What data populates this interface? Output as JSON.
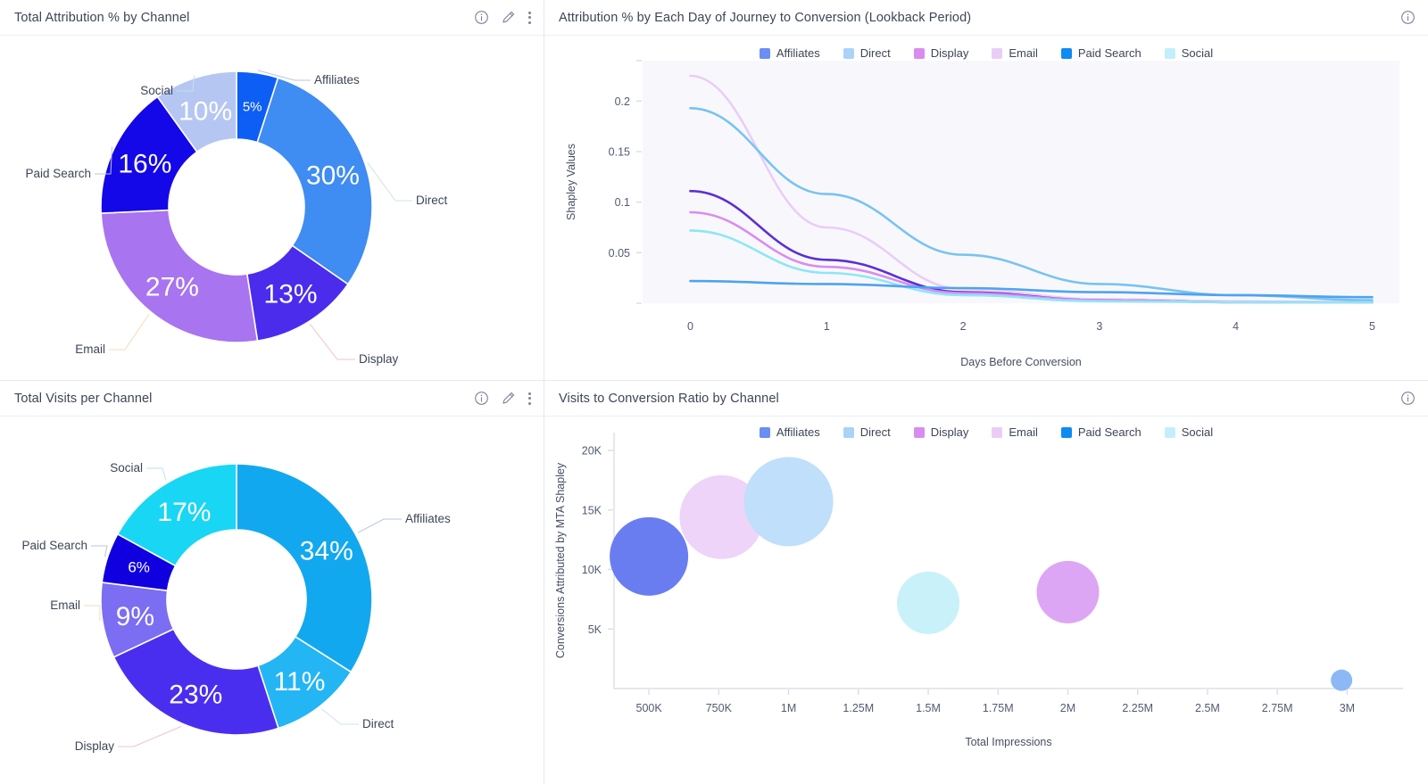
{
  "palette": {
    "affiliates": "#1877f2",
    "direct": "#a9d3f8",
    "display": "#d98cf0",
    "email": "#eacdf7",
    "paid_search": "#0d8bf2",
    "social": "#c4eefc",
    "donut1": {
      "affiliates": "#0d5ef5",
      "direct": "#3f8cf2",
      "display": "#4b2ced",
      "email": "#a874f0",
      "paid_search": "#1407e8",
      "social": "#b6c6f2"
    },
    "donut2": {
      "affiliates": "#12a8f0",
      "direct": "#24b5f5",
      "display": "#4a2ef0",
      "email": "#7b6ef2",
      "paid_search": "#1000e0",
      "social": "#1ad6f5"
    },
    "bubble": {
      "affiliates": "#6a7df0",
      "direct": "#b6daf9",
      "display": "#dca6f5",
      "email": "#eed4f8",
      "paid_search": "#8ba6f7",
      "social": "#c9f1f9"
    },
    "plot_bg": "#f8f8fc",
    "axis": "#d8dbe4"
  },
  "panels": {
    "total_attribution": {
      "title": "Total Attribution % by Channel",
      "actions": [
        "info-icon",
        "edit-icon",
        "more-icon"
      ]
    },
    "attribution_by_day": {
      "title": "Attribution % by Each Day of Journey to Conversion (Lookback Period)",
      "actions": [
        "info-icon"
      ]
    },
    "total_visits": {
      "title": "Total Visits per Channel",
      "actions": [
        "info-icon",
        "edit-icon",
        "more-icon"
      ]
    },
    "visits_ratio": {
      "title": "Visits to Conversion Ratio by Channel",
      "actions": [
        "info-icon"
      ]
    }
  },
  "legend_channels": [
    {
      "label": "Affiliates",
      "color": "#6a8ef2"
    },
    {
      "label": "Direct",
      "color": "#a9d3f8"
    },
    {
      "label": "Display",
      "color": "#d98cf0"
    },
    {
      "label": "Email",
      "color": "#eacdf7"
    },
    {
      "label": "Paid Search",
      "color": "#0d8bf2"
    },
    {
      "label": "Social",
      "color": "#c4eefc"
    }
  ],
  "chart_data": [
    {
      "id": "total-attribution-donut",
      "type": "pie",
      "title": "Total Attribution % by Channel",
      "donut": true,
      "labels": [
        "Affiliates",
        "Direct",
        "Display",
        "Email",
        "Paid Search",
        "Social"
      ],
      "values": [
        5,
        30,
        13,
        27,
        16,
        10
      ],
      "value_labels": [
        "5%",
        "30%",
        "13%",
        "27%",
        "16%",
        "10%"
      ],
      "colors": [
        "#0d5ef5",
        "#3f8cf2",
        "#4b2ced",
        "#a874f0",
        "#1407e8",
        "#b6c6f2"
      ],
      "legend": "none"
    },
    {
      "id": "attribution-by-day-line",
      "type": "line",
      "title": "Attribution % by Each Day of Journey to Conversion (Lookback Period)",
      "xlabel": "Days Before Conversion",
      "ylabel": "Shapley Values",
      "x": [
        0,
        1,
        2,
        3,
        4,
        5
      ],
      "xticks": [
        "0",
        "1",
        "2",
        "3",
        "4",
        "5"
      ],
      "yticks": [
        "0.05",
        "0.1",
        "0.15",
        "0.2"
      ],
      "ylim": [
        0,
        0.24
      ],
      "xlim": [
        -0.35,
        5.2
      ],
      "grid": false,
      "legend": "top",
      "series": [
        {
          "name": "Email",
          "color": "#eacdf7",
          "values": [
            0.225,
            0.075,
            0.014,
            0.004,
            0.002,
            0.001
          ]
        },
        {
          "name": "Direct",
          "color": "#79c3f2",
          "values": [
            0.193,
            0.108,
            0.048,
            0.019,
            0.008,
            0.003
          ]
        },
        {
          "name": "Paid Search",
          "color": "#5b2fd6",
          "values": [
            0.111,
            0.043,
            0.011,
            0.003,
            0.001,
            0.001
          ]
        },
        {
          "name": "Display",
          "color": "#d98cf0",
          "values": [
            0.09,
            0.036,
            0.01,
            0.003,
            0.001,
            0.001
          ]
        },
        {
          "name": "Social",
          "color": "#8fe6f5",
          "values": [
            0.072,
            0.03,
            0.008,
            0.002,
            0.001,
            0.001
          ]
        },
        {
          "name": "Affiliates",
          "color": "#4ea3f0",
          "values": [
            0.022,
            0.019,
            0.015,
            0.011,
            0.008,
            0.006
          ]
        }
      ]
    },
    {
      "id": "total-visits-donut",
      "type": "pie",
      "title": "Total Visits per Channel",
      "donut": true,
      "labels": [
        "Affiliates",
        "Direct",
        "Display",
        "Email",
        "Paid Search",
        "Social"
      ],
      "values": [
        34,
        11,
        23,
        9,
        6,
        17
      ],
      "value_labels": [
        "34%",
        "11%",
        "23%",
        "9%",
        "6%",
        "17%"
      ],
      "colors": [
        "#12a8f0",
        "#24b5f5",
        "#4a2ef0",
        "#7b6ef2",
        "#1000e0",
        "#1ad6f5"
      ],
      "legend": "none"
    },
    {
      "id": "visits-conversion-bubble",
      "type": "scatter",
      "title": "Visits to Conversion Ratio by Channel",
      "xlabel": "Total Impressions",
      "ylabel": "Conversions Attributed by MTA Shapley",
      "xticks": [
        "500K",
        "750K",
        "1M",
        "1.25M",
        "1.5M",
        "1.75M",
        "2M",
        "2.25M",
        "2.5M",
        "2.75M",
        "3M"
      ],
      "yticks": [
        "5K",
        "10K",
        "15K",
        "20K"
      ],
      "xlim": [
        375000,
        3200000
      ],
      "ylim": [
        0,
        21500
      ],
      "legend": "top",
      "points": [
        {
          "name": "Paid Search",
          "x": 500000,
          "y": 11100,
          "size": 44,
          "color": "#6a7df0"
        },
        {
          "name": "Email",
          "x": 760000,
          "y": 14400,
          "size": 47,
          "color": "#eed4f8"
        },
        {
          "name": "Direct",
          "x": 1000000,
          "y": 15700,
          "size": 50,
          "color": "#bfdffb"
        },
        {
          "name": "Social",
          "x": 1500000,
          "y": 7200,
          "size": 35,
          "color": "#c9f1f9"
        },
        {
          "name": "Display",
          "x": 2000000,
          "y": 8100,
          "size": 35,
          "color": "#dca6f5"
        },
        {
          "name": "Affiliates",
          "x": 2980000,
          "y": 700,
          "size": 12,
          "color": "#8cb8f5"
        }
      ]
    }
  ]
}
